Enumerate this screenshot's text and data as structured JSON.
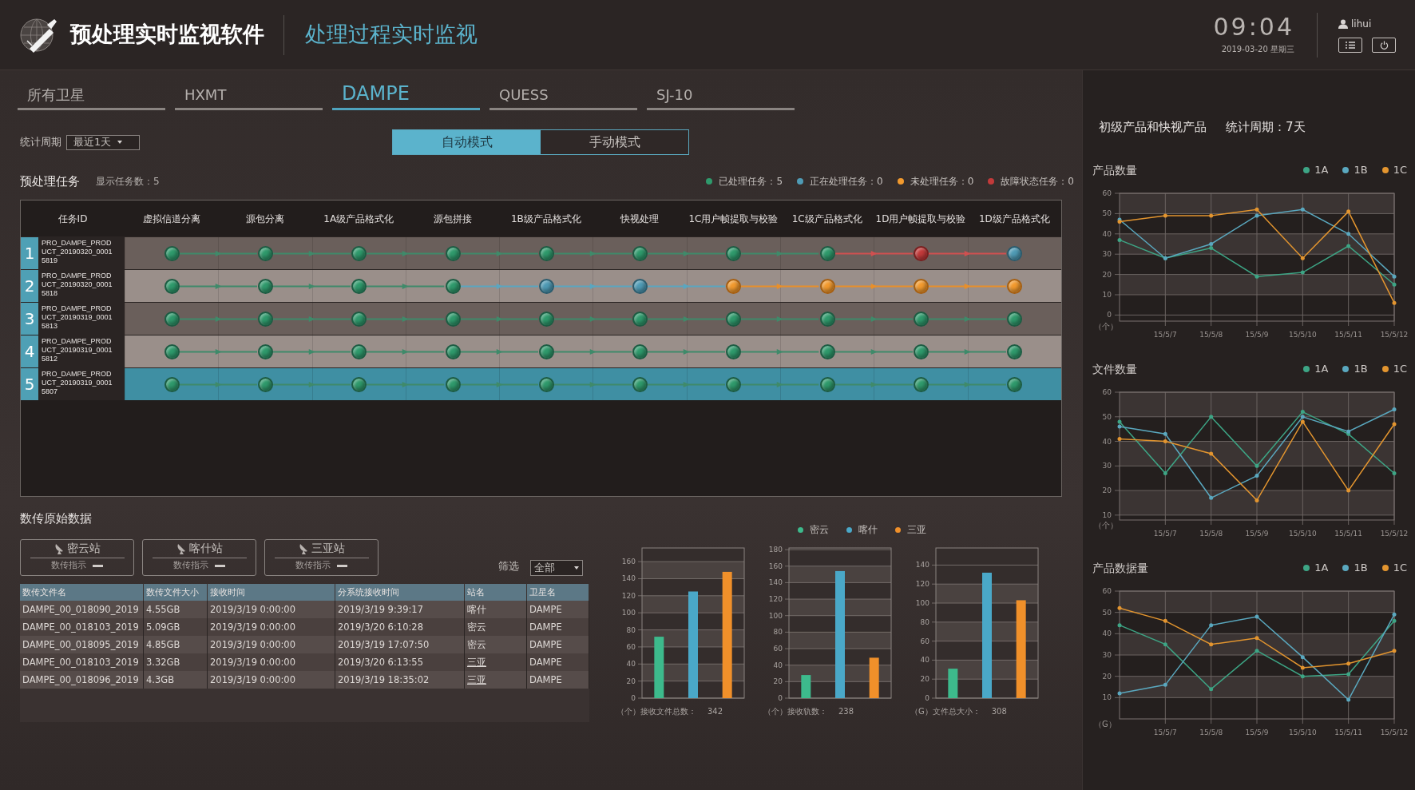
{
  "header": {
    "app_title": "预处理实时监视软件",
    "page_title": "处理过程实时监视",
    "time": "09:04",
    "date": "2019-03-20 星期三",
    "user": "lihui"
  },
  "tabs": [
    {
      "label": "所有卫星",
      "selected": false
    },
    {
      "label": "HXMT",
      "selected": false
    },
    {
      "label": "DAMPE",
      "selected": true
    },
    {
      "label": "QUESS",
      "selected": false
    },
    {
      "label": "SJ-10",
      "selected": false
    }
  ],
  "period": {
    "label": "统计周期",
    "value": "最近1天"
  },
  "modes": [
    {
      "label": "自动模式",
      "selected": true
    },
    {
      "label": "手动模式",
      "selected": false
    }
  ],
  "tasks": {
    "title": "预处理任务",
    "count": "显示任务数：5",
    "legend": [
      {
        "kind": "done",
        "label": "已处理任务：5"
      },
      {
        "kind": "processing",
        "label": "正在处理任务：0"
      },
      {
        "kind": "pending",
        "label": "未处理任务：0"
      },
      {
        "kind": "fault",
        "label": "故障状态任务：0"
      }
    ],
    "columns": [
      "任务ID",
      "虚拟信道分离",
      "源包分离",
      "1A级产品格式化",
      "源包拼接",
      "1B级产品格式化",
      "快视处理",
      "1C用户帧提取与校验",
      "1C级产品格式化",
      "1D用户帧提取与校验",
      "1D级产品格式化"
    ],
    "rows": [
      {
        "number": "1",
        "id": "PRO_DAMPE_PRODUCT_20190320_00015819",
        "selected": false,
        "stages": [
          {
            "kind": "done"
          },
          {
            "kind": "done"
          },
          {
            "kind": "done"
          },
          {
            "kind": "done"
          },
          {
            "kind": "done"
          },
          {
            "kind": "done"
          },
          {
            "kind": "done"
          },
          {
            "kind": "done"
          },
          {
            "kind": "fault"
          },
          {
            "kind": "processing"
          }
        ]
      },
      {
        "number": "2",
        "id": "PRO_DAMPE_PRODUCT_20190320_00015818",
        "selected": false,
        "stages": [
          {
            "kind": "done"
          },
          {
            "kind": "done"
          },
          {
            "kind": "done"
          },
          {
            "kind": "done"
          },
          {
            "kind": "processing"
          },
          {
            "kind": "processing"
          },
          {
            "kind": "pending"
          },
          {
            "kind": "pending"
          },
          {
            "kind": "pending"
          },
          {
            "kind": "pending"
          }
        ]
      },
      {
        "number": "3",
        "id": "PRO_DAMPE_PRODUCT_20190319_00015813",
        "selected": false,
        "stages": [
          {
            "kind": "done"
          },
          {
            "kind": "done"
          },
          {
            "kind": "done"
          },
          {
            "kind": "done"
          },
          {
            "kind": "done"
          },
          {
            "kind": "done"
          },
          {
            "kind": "done"
          },
          {
            "kind": "done"
          },
          {
            "kind": "done"
          },
          {
            "kind": "done"
          }
        ]
      },
      {
        "number": "4",
        "id": "PRO_DAMPE_PRODUCT_20190319_00015812",
        "selected": false,
        "stages": [
          {
            "kind": "done"
          },
          {
            "kind": "done"
          },
          {
            "kind": "done"
          },
          {
            "kind": "done"
          },
          {
            "kind": "done"
          },
          {
            "kind": "done"
          },
          {
            "kind": "done"
          },
          {
            "kind": "done"
          },
          {
            "kind": "done"
          },
          {
            "kind": "done"
          }
        ]
      },
      {
        "number": "5",
        "id": "PRO_DAMPE_PRODUCT_20190319_00015807",
        "selected": true,
        "stages": [
          {
            "kind": "done"
          },
          {
            "kind": "done"
          },
          {
            "kind": "done"
          },
          {
            "kind": "done"
          },
          {
            "kind": "done"
          },
          {
            "kind": "done"
          },
          {
            "kind": "done"
          },
          {
            "kind": "done"
          },
          {
            "kind": "done"
          },
          {
            "kind": "done"
          }
        ]
      }
    ]
  },
  "raw_data": {
    "title": "数传原始数据",
    "stations": [
      {
        "name": "密云站",
        "indicator_label": "数传指示"
      },
      {
        "name": "喀什站",
        "indicator_label": "数传指示"
      },
      {
        "name": "三亚站",
        "indicator_label": "数传指示"
      }
    ],
    "filter": {
      "label": "筛选",
      "value": "全部"
    },
    "columns": [
      "数传文件名",
      "数传文件大小",
      "接收时间",
      "分系统接收时间",
      "站名",
      "卫星名"
    ],
    "rows": [
      {
        "cells": [
          "DAMPE_00_018090_2019",
          "4.55GB",
          "2019/3/19 0:00:00",
          "2019/3/19 9:39:17",
          "喀什",
          "DAMPE"
        ],
        "station_link": false
      },
      {
        "cells": [
          "DAMPE_00_018103_2019",
          "5.09GB",
          "2019/3/19 0:00:00",
          "2019/3/20 6:10:28",
          "密云",
          "DAMPE"
        ],
        "station_link": false
      },
      {
        "cells": [
          "DAMPE_00_018095_2019",
          "4.85GB",
          "2019/3/19 0:00:00",
          "2019/3/19 17:07:50",
          "密云",
          "DAMPE"
        ],
        "station_link": false
      },
      {
        "cells": [
          "DAMPE_00_018103_2019",
          "3.32GB",
          "2019/3/19 0:00:00",
          "2019/3/20 6:13:55",
          "三亚",
          "DAMPE"
        ],
        "station_link": true
      },
      {
        "cells": [
          "DAMPE_00_018096_2019",
          "4.3GB",
          "2019/3/19 0:00:00",
          "2019/3/19 18:35:02",
          "三亚",
          "DAMPE"
        ],
        "station_link": true
      }
    ],
    "station_legend": [
      {
        "label": "密云",
        "color": "#3dba8c"
      },
      {
        "label": "喀什",
        "color": "#4aa8c8"
      },
      {
        "label": "三亚",
        "color": "#f0902a"
      }
    ],
    "bar_charts": [
      {
        "footer_label": "（个）接收文件总数：",
        "footer_value": "342",
        "chart_data": {
          "type": "bar",
          "categories": [
            null
          ],
          "grid": true,
          "ylim": [
            0,
            176
          ],
          "yticks": [
            0,
            20,
            40,
            60,
            80,
            100,
            120,
            140,
            160
          ],
          "series": [
            {
              "color": "#3dba8c",
              "values": [
                72
              ]
            },
            {
              "color": "#4aa8c8",
              "values": [
                125
              ]
            },
            {
              "color": "#f0902a",
              "values": [
                148
              ]
            }
          ]
        }
      },
      {
        "footer_label": "（个）接收轨数：",
        "footer_value": "238",
        "chart_data": {
          "type": "bar",
          "categories": [
            null
          ],
          "grid": true,
          "ylim": [
            0,
            182
          ],
          "yticks": [
            0,
            20,
            40,
            60,
            80,
            100,
            120,
            140,
            160,
            180
          ],
          "series": [
            {
              "color": "#3dba8c",
              "values": [
                28
              ]
            },
            {
              "color": "#4aa8c8",
              "values": [
                154
              ]
            },
            {
              "color": "#f0902a",
              "values": [
                49
              ]
            }
          ]
        }
      },
      {
        "footer_label": "（G）文件总大小：",
        "footer_value": "308",
        "chart_data": {
          "type": "bar",
          "categories": [
            null
          ],
          "grid": true,
          "ylim": [
            0,
            158
          ],
          "yticks": [
            0,
            20,
            40,
            60,
            80,
            100,
            120,
            140
          ],
          "series": [
            {
              "color": "#3dba8c",
              "values": [
                31
              ]
            },
            {
              "color": "#4aa8c8",
              "values": [
                132
              ]
            },
            {
              "color": "#f0902a",
              "values": [
                103
              ]
            }
          ]
        }
      }
    ]
  },
  "products": {
    "title": "初级产品和快视产品",
    "period": "统计周期：7天",
    "charts": [
      {
        "chart_data": {
          "type": "line",
          "grid": true,
          "title": "产品数量",
          "ylabel": "（个）",
          "categories": [
            null,
            "15/5/7",
            "15/5/8",
            "15/5/9",
            "15/5/10",
            "15/5/11",
            "15/5/12"
          ],
          "bands": [
            {
              "axis": "y",
              "from": 10,
              "to": 20
            },
            {
              "axis": "y",
              "from": 30,
              "to": 40
            },
            {
              "axis": "y",
              "from": 50,
              "to": 60
            }
          ],
          "ylim": [
            -3,
            60
          ],
          "yticks": [
            0,
            10,
            20,
            30,
            40,
            50,
            60
          ],
          "series": [
            {
              "name": "1A",
              "color": "#3da585",
              "values": [
                37,
                28,
                33,
                19,
                21,
                34,
                15
              ]
            },
            {
              "name": "1B",
              "color": "#5aa8bf",
              "values": [
                47,
                28,
                35,
                49,
                52,
                40,
                19
              ]
            },
            {
              "name": "1C",
              "color": "#e3952f",
              "values": [
                46,
                49,
                49,
                52,
                28,
                51,
                6
              ]
            }
          ]
        }
      },
      {
        "chart_data": {
          "type": "line",
          "grid": true,
          "title": "文件数量",
          "ylabel": "（个）",
          "categories": [
            null,
            "15/5/7",
            "15/5/8",
            "15/5/9",
            "15/5/10",
            "15/5/11",
            "15/5/12"
          ],
          "bands": [
            {
              "axis": "y",
              "from": 10,
              "to": 20
            },
            {
              "axis": "y",
              "from": 30,
              "to": 40
            },
            {
              "axis": "y",
              "from": 50,
              "to": 60
            }
          ],
          "ylim": [
            8,
            60
          ],
          "yticks": [
            10,
            20,
            30,
            40,
            50,
            60
          ],
          "series": [
            {
              "name": "1A",
              "color": "#3da585",
              "values": [
                48,
                27,
                50,
                30,
                52,
                43,
                27
              ]
            },
            {
              "name": "1B",
              "color": "#5aa8bf",
              "values": [
                46,
                43,
                17,
                26,
                50,
                44,
                53
              ]
            },
            {
              "name": "1C",
              "color": "#e3952f",
              "values": [
                41,
                40,
                35,
                16,
                48,
                20,
                47
              ]
            }
          ]
        }
      },
      {
        "chart_data": {
          "type": "line",
          "grid": true,
          "title": "产品数据量",
          "ylabel": "（G）",
          "categories": [
            null,
            "15/5/7",
            "15/5/8",
            "15/5/9",
            "15/5/10",
            "15/5/11",
            "15/5/12"
          ],
          "bands": [
            {
              "axis": "y",
              "from": 10,
              "to": 20
            },
            {
              "axis": "y",
              "from": 30,
              "to": 40
            },
            {
              "axis": "y",
              "from": 50,
              "to": 60
            }
          ],
          "ylim": [
            0,
            60
          ],
          "yticks": [
            10,
            20,
            30,
            40,
            50,
            60
          ],
          "series": [
            {
              "name": "1A",
              "color": "#3da585",
              "values": [
                44,
                35,
                14,
                32,
                20,
                21,
                46
              ]
            },
            {
              "name": "1B",
              "color": "#5aa8bf",
              "values": [
                12,
                16,
                44,
                48,
                29,
                9,
                49
              ]
            },
            {
              "name": "1C",
              "color": "#e3952f",
              "values": [
                52,
                46,
                35,
                38,
                24,
                26,
                32
              ]
            }
          ]
        }
      }
    ]
  }
}
